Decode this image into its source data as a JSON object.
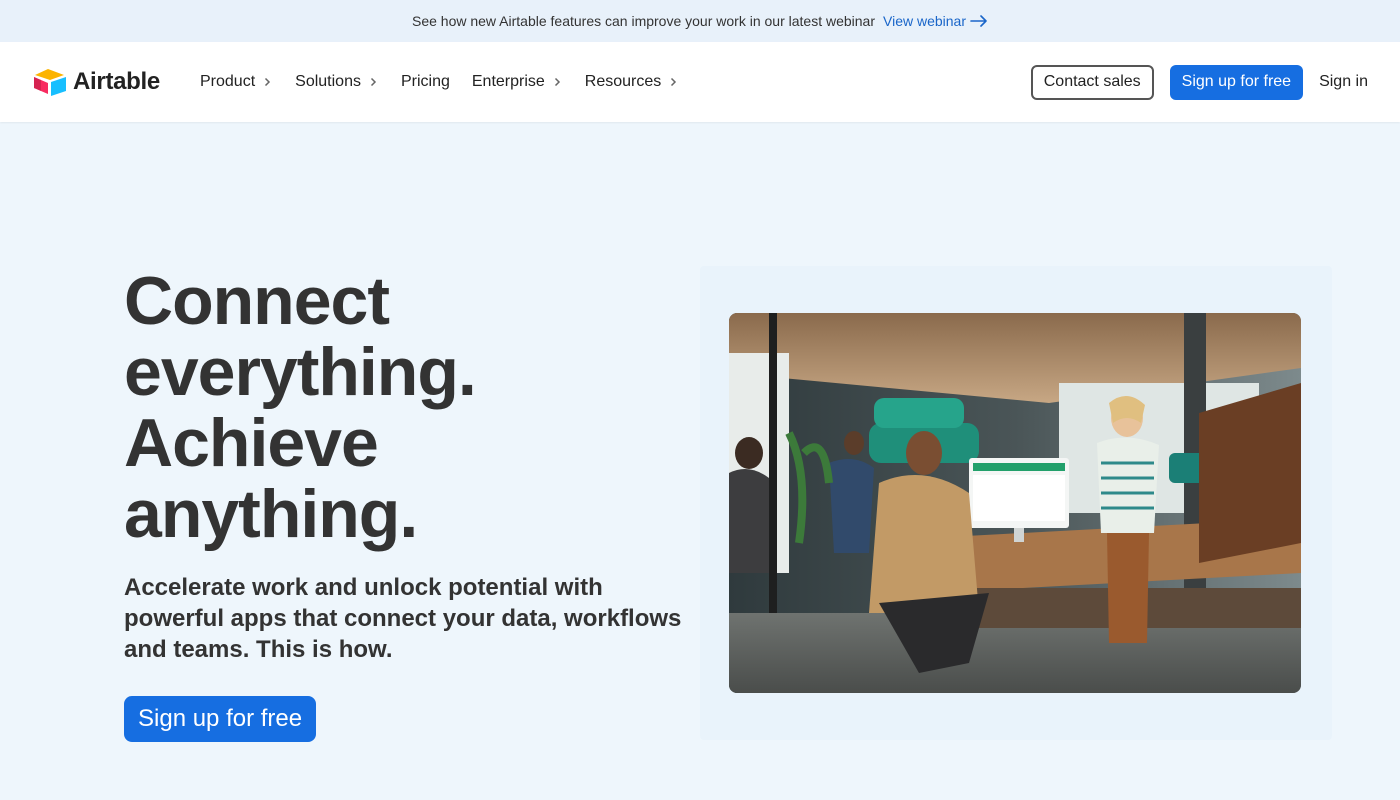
{
  "banner": {
    "text": "See how new Airtable features can improve your work in our latest webinar",
    "link_label": "View webinar",
    "link_icon": "arrow-right-icon"
  },
  "nav": {
    "logo_text": "Airtable",
    "menu": [
      {
        "label": "Product",
        "has_chevron": true
      },
      {
        "label": "Solutions",
        "has_chevron": true
      },
      {
        "label": "Pricing",
        "has_chevron": false
      },
      {
        "label": "Enterprise",
        "has_chevron": true
      },
      {
        "label": "Resources",
        "has_chevron": true
      }
    ],
    "contact_sales": "Contact sales",
    "sign_up": "Sign up for free",
    "sign_in": "Sign in"
  },
  "hero": {
    "title_lines": [
      "Connect",
      "everything.",
      "Achieve",
      "anything."
    ],
    "subtitle": "Accelerate work and unlock potential with powerful apps that connect your data, workflows and teams. This is how.",
    "cta": "Sign up for free"
  },
  "colors": {
    "accent": "#166ee1",
    "link": "#1a66c9",
    "background": "#eef6fc",
    "banner_bg": "#e8f1fa",
    "logo_yellow": "#fcb400",
    "logo_red": "#f82b60",
    "logo_blue": "#18bfff"
  }
}
